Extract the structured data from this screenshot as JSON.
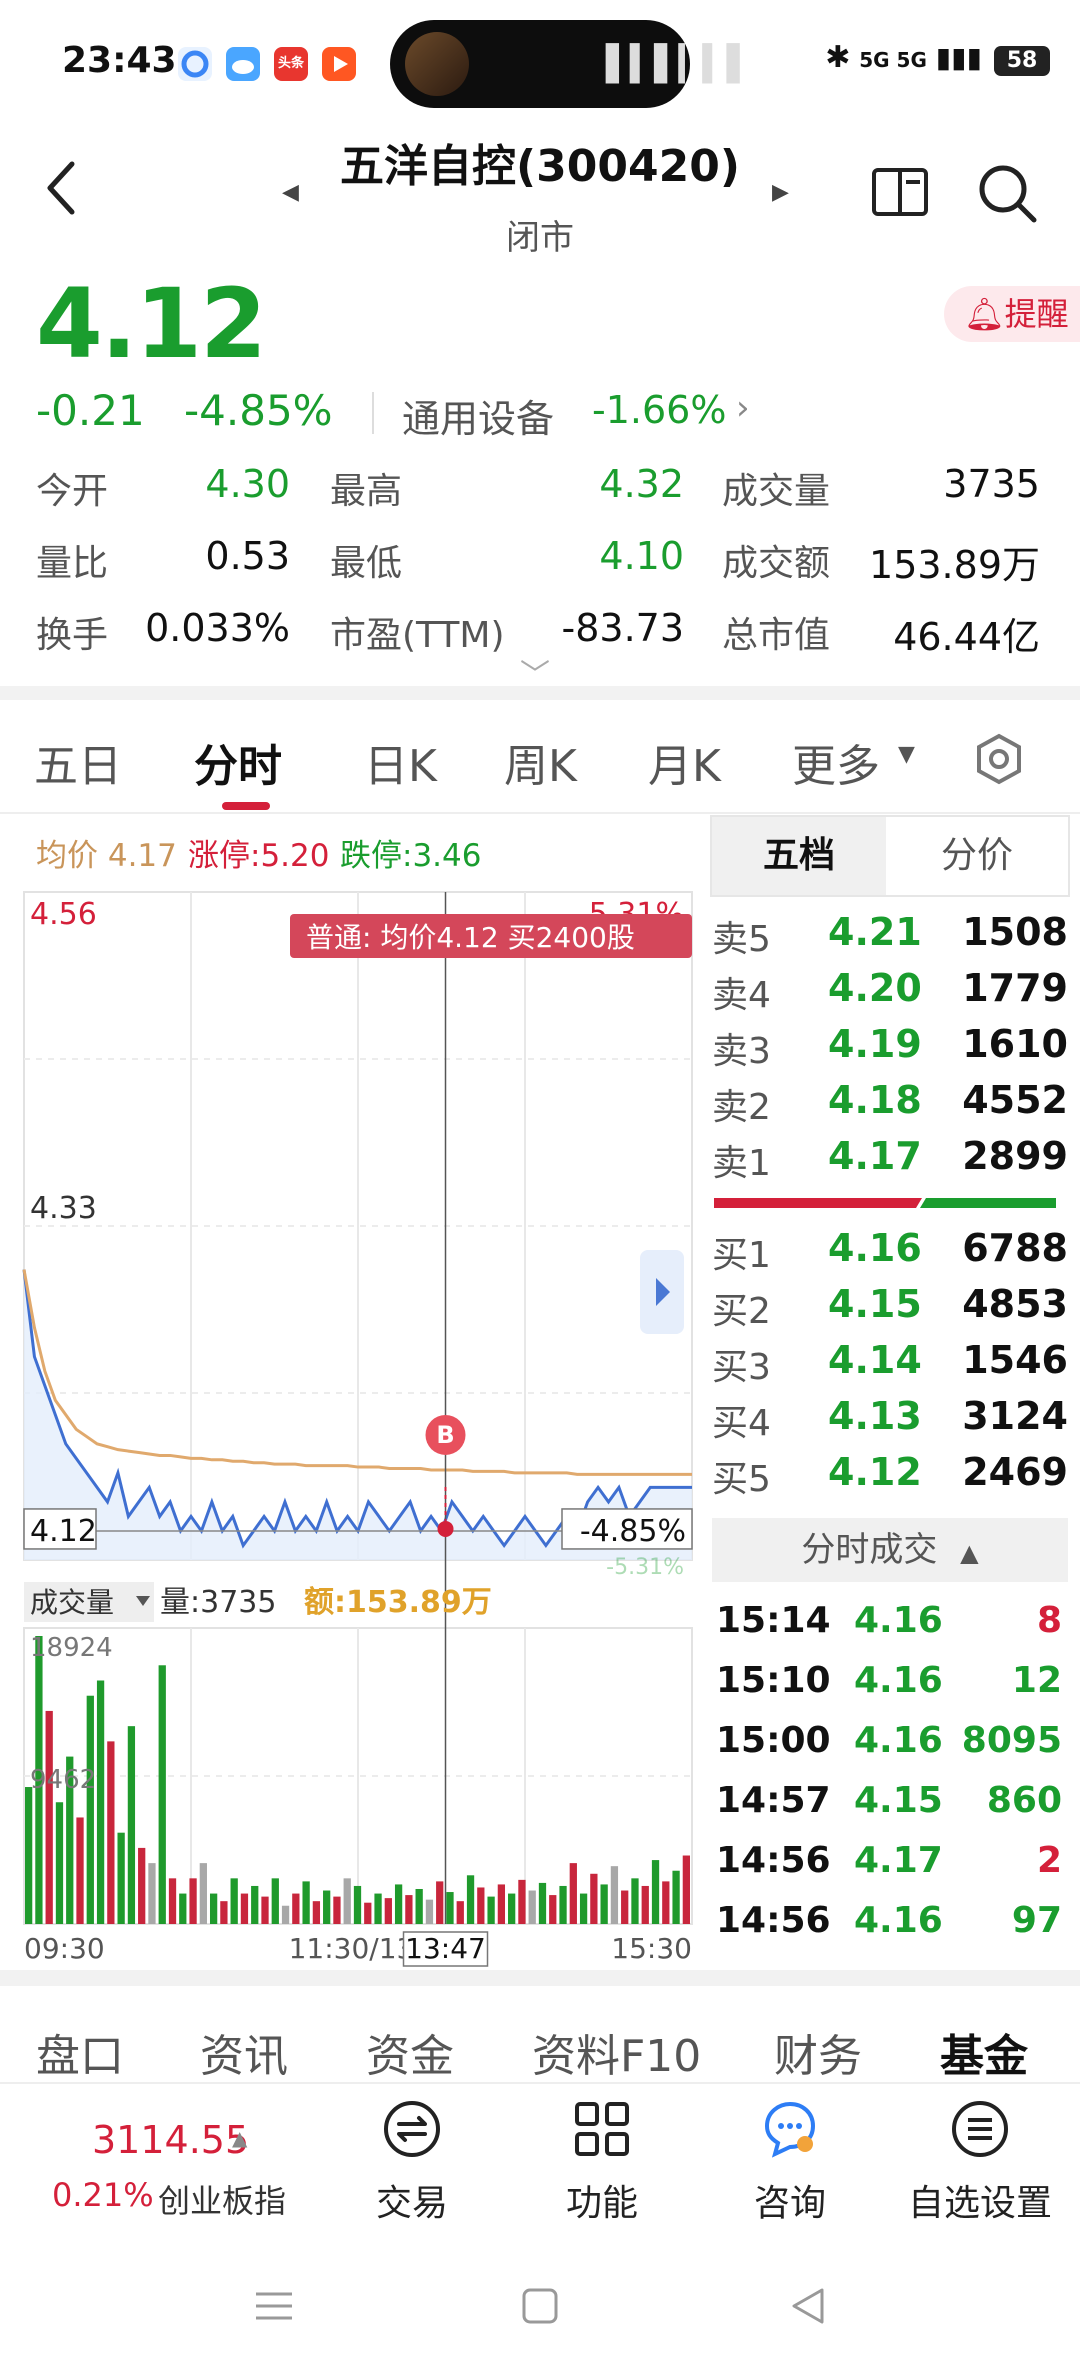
{
  "status_bar": {
    "time": "23:43",
    "network": "5G 5G",
    "battery": "58",
    "app_badge": "头条"
  },
  "header": {
    "title": "五洋自控(300420)",
    "subtitle": "闭市"
  },
  "quote": {
    "price": "4.12",
    "change": "-0.21",
    "change_pct": "-4.85%",
    "sector": "通用设备",
    "sector_pct": "-1.66%",
    "alert_label": "提醒",
    "stats": [
      [
        {
          "label": "今开",
          "value": "4.30",
          "color": "green"
        },
        {
          "label": "最高",
          "value": "4.32",
          "color": "green"
        },
        {
          "label": "成交量",
          "value": "3735",
          "color": "dark"
        }
      ],
      [
        {
          "label": "量比",
          "value": "0.53",
          "color": "dark"
        },
        {
          "label": "最低",
          "value": "4.10",
          "color": "green"
        },
        {
          "label": "成交额",
          "value": "153.89万",
          "color": "dark"
        }
      ],
      [
        {
          "label": "换手",
          "value": "0.033%",
          "color": "dark"
        },
        {
          "label": "市盈(TTM)",
          "value": "-83.73",
          "color": "dark"
        },
        {
          "label": "总市值",
          "value": "46.44亿",
          "color": "dark"
        }
      ]
    ]
  },
  "tabs": [
    "五日",
    "分时",
    "日K",
    "周K",
    "月K",
    "更多"
  ],
  "tabs_active": "分时",
  "chart_header": {
    "avg": "均价 4.17",
    "limit_up": "涨停:5.20",
    "limit_down": "跌停:3.46"
  },
  "chart_data": {
    "type": "line",
    "price_labels": {
      "top": "4.56",
      "mid": "4.33",
      "current": "4.12",
      "pct_top": "5.31%",
      "pct_current": "-4.85%",
      "pct_bottom": "-5.31%"
    },
    "tooltip": "普通: 均价4.12 买2400股",
    "marker": "B",
    "ylim": [
      4.1,
      4.56
    ],
    "price_series": [
      4.3,
      4.24,
      4.22,
      4.2,
      4.18,
      4.17,
      4.16,
      4.15,
      4.14,
      4.16,
      4.13,
      4.14,
      4.15,
      4.13,
      4.14,
      4.12,
      4.13,
      4.12,
      4.14,
      4.12,
      4.13,
      4.11,
      4.12,
      4.13,
      4.12,
      4.14,
      4.12,
      4.13,
      4.12,
      4.14,
      4.12,
      4.13,
      4.12,
      4.14,
      4.13,
      4.12,
      4.13,
      4.14,
      4.12,
      4.13,
      4.12,
      4.14,
      4.13,
      4.12,
      4.13,
      4.12,
      4.11,
      4.12,
      4.13,
      4.12,
      4.11,
      4.12,
      4.13,
      4.12,
      4.14,
      4.15,
      4.14,
      4.15,
      4.13,
      4.14,
      4.15,
      4.15,
      4.15,
      4.15,
      4.15
    ],
    "avg_series": [
      4.3,
      4.26,
      4.23,
      4.21,
      4.2,
      4.19,
      4.185,
      4.18,
      4.178,
      4.176,
      4.175,
      4.174,
      4.173,
      4.172,
      4.172,
      4.171,
      4.17,
      4.17,
      4.169,
      4.169,
      4.168,
      4.168,
      4.167,
      4.167,
      4.166,
      4.166,
      4.166,
      4.165,
      4.165,
      4.165,
      4.165,
      4.165,
      4.164,
      4.164,
      4.164,
      4.163,
      4.163,
      4.163,
      4.163,
      4.162,
      4.162,
      4.162,
      4.162,
      4.161,
      4.161,
      4.161,
      4.161,
      4.16,
      4.16,
      4.16,
      4.16,
      4.16,
      4.16,
      4.159,
      4.159,
      4.159,
      4.159,
      4.159,
      4.159,
      4.159,
      4.159,
      4.159,
      4.159,
      4.159,
      4.159
    ],
    "volume_label": "成交量",
    "volume_text": "量:3735",
    "amount_text": "额:153.89万",
    "volume_ticks": [
      "18924",
      "9462"
    ],
    "volume_max": 18924,
    "volumes": [
      9000,
      18924,
      14000,
      8000,
      11000,
      7000,
      15000,
      16000,
      12000,
      6000,
      13000,
      5000,
      4000,
      17000,
      3000,
      2000,
      3000,
      4000,
      2000,
      1500,
      3000,
      2000,
      2500,
      1800,
      3000,
      1200,
      2000,
      2800,
      1500,
      2200,
      1800,
      3000,
      2500,
      1400,
      2000,
      1700,
      2600,
      1900,
      2300,
      1600,
      2800,
      2100,
      1500,
      3200,
      2400,
      1800,
      2600,
      2000,
      2900,
      2200,
      2700,
      1900,
      2500,
      4000,
      2000,
      3300,
      2600,
      3800,
      2200,
      3000,
      2500,
      4200,
      2800,
      3500,
      4500
    ],
    "volume_colors": [
      "g",
      "g",
      "r",
      "g",
      "g",
      "r",
      "g",
      "g",
      "r",
      "g",
      "g",
      "r",
      "gr",
      "g",
      "r",
      "g",
      "r",
      "gr",
      "g",
      "r",
      "g",
      "r",
      "g",
      "r",
      "g",
      "gr",
      "r",
      "g",
      "r",
      "g",
      "r",
      "gr",
      "g",
      "r",
      "g",
      "r",
      "g",
      "r",
      "g",
      "gr",
      "r",
      "g",
      "r",
      "g",
      "r",
      "g",
      "r",
      "g",
      "r",
      "gr",
      "g",
      "r",
      "g",
      "r",
      "g",
      "r",
      "g",
      "gr",
      "r",
      "g",
      "r",
      "g",
      "r",
      "g",
      "r"
    ],
    "x_labels": [
      "09:30",
      "11:30/13:00",
      "13:47",
      "15:30"
    ]
  },
  "order_book": {
    "tabs": [
      "五档",
      "分价"
    ],
    "asks": [
      {
        "label": "卖5",
        "price": "4.21",
        "volume": "1508"
      },
      {
        "label": "卖4",
        "price": "4.20",
        "volume": "1779"
      },
      {
        "label": "卖3",
        "price": "4.19",
        "volume": "1610"
      },
      {
        "label": "卖2",
        "price": "4.18",
        "volume": "4552"
      },
      {
        "label": "卖1",
        "price": "4.17",
        "volume": "2899"
      }
    ],
    "bids": [
      {
        "label": "买1",
        "price": "4.16",
        "volume": "6788"
      },
      {
        "label": "买2",
        "price": "4.15",
        "volume": "4853"
      },
      {
        "label": "买3",
        "price": "4.14",
        "volume": "1546"
      },
      {
        "label": "买4",
        "price": "4.13",
        "volume": "3124"
      },
      {
        "label": "买5",
        "price": "4.12",
        "volume": "2469"
      }
    ]
  },
  "trades": {
    "title": "分时成交",
    "rows": [
      {
        "time": "15:14",
        "price": "4.16",
        "volume": "8",
        "color": "red"
      },
      {
        "time": "15:10",
        "price": "4.16",
        "volume": "12",
        "color": "green"
      },
      {
        "time": "15:00",
        "price": "4.16",
        "volume": "8095",
        "color": "green"
      },
      {
        "time": "14:57",
        "price": "4.15",
        "volume": "860",
        "color": "green"
      },
      {
        "time": "14:56",
        "price": "4.17",
        "volume": "2",
        "color": "red"
      },
      {
        "time": "14:56",
        "price": "4.16",
        "volume": "97",
        "color": "green"
      }
    ]
  },
  "bottom_tabs": [
    "盘口",
    "资讯",
    "资金",
    "资料F10",
    "财务",
    "基金"
  ],
  "bottom_tabs_active": "基金",
  "bottom_nav": {
    "index_value": "3114.55",
    "index_pct": "0.21%",
    "index_name": "创业板指",
    "items": [
      "交易",
      "功能",
      "咨询",
      "自选设置"
    ]
  }
}
